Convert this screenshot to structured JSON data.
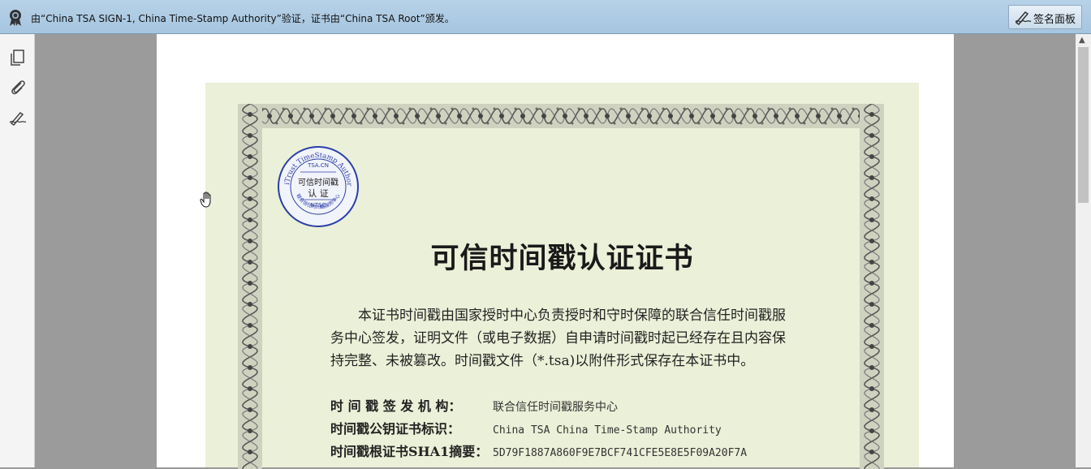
{
  "signature_bar": {
    "message": "由“China TSA SIGN-1, China Time-Stamp Authority”验证，证书由“China TSA Root”颁发。",
    "panel_button_label": "签名面板"
  },
  "left_tools": [
    "pages-icon",
    "attachment-icon",
    "signature-icon"
  ],
  "certificate": {
    "stamp": {
      "top_text": "UniTrust TimeStamp Authority",
      "domain": "TSA.CN",
      "center_line1": "可信时间戳",
      "center_line2": "认 证",
      "bottom_code": "NTSC",
      "bottom_text": "联合信任时间戳服务中心"
    },
    "title": "可信时间戳认证证书",
    "body": "　　本证书时间戳由国家授时中心负责授时和守时保障的联合信任时间戳服务中心签发，证明文件（或电子数据）自申请时间戳时起已经存在且内容保持完整、未被篡改。时间戳文件（*.tsa)以附件形式保存在本证书中。",
    "fields": [
      {
        "label": "时 间 戳 签 发 机 构：",
        "value": "联合信任时间戳服务中心"
      },
      {
        "label": "时间戳公钥证书标识：",
        "value": "China TSA China Time-Stamp Authority"
      },
      {
        "label": "时间戳根证书SHA1摘要：",
        "value": "5D79F1887A860F9E7BCF741CFE5E8E5F09A20F7A"
      }
    ]
  },
  "colors": {
    "signature_bar": "#a6c5df",
    "certificate_background": "#ebf0d8",
    "stamp_blue": "#2b3fa8",
    "viewer_background": "#9b9b9b"
  }
}
